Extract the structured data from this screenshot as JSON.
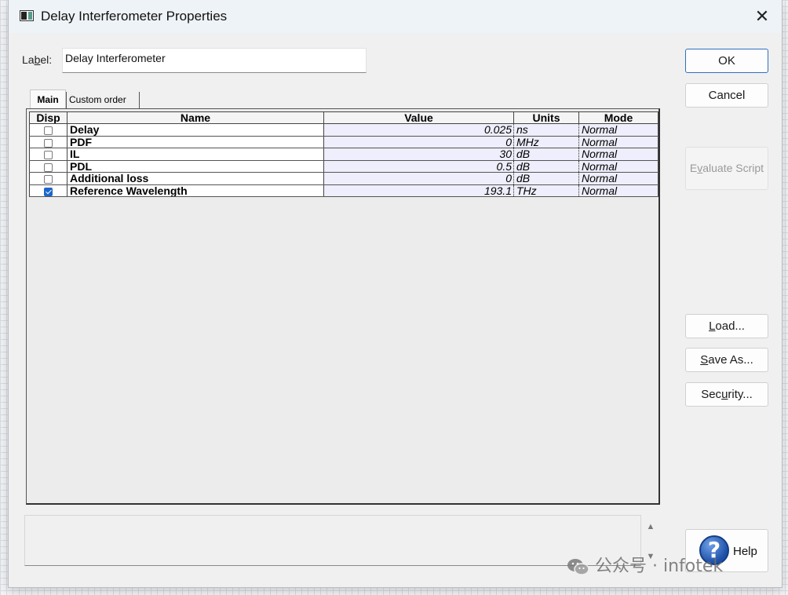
{
  "window": {
    "title": "Delay Interferometer Properties",
    "close_glyph": "✕"
  },
  "label_field": {
    "label_pre": "La",
    "label_key": "b",
    "label_post": "el:",
    "value": "Delay Interferometer"
  },
  "tabs": [
    {
      "label": "Main",
      "active": true
    },
    {
      "label": "Custom order",
      "active": false
    }
  ],
  "table": {
    "headers": [
      "Disp",
      "Name",
      "Value",
      "Units",
      "Mode"
    ],
    "rows": [
      {
        "disp": false,
        "name": "Delay",
        "value": "0.025",
        "units": "ns",
        "mode": "Normal"
      },
      {
        "disp": false,
        "name": "PDF",
        "value": "0",
        "units": "MHz",
        "mode": "Normal"
      },
      {
        "disp": false,
        "name": "IL",
        "value": "30",
        "units": "dB",
        "mode": "Normal"
      },
      {
        "disp": false,
        "name": "PDL",
        "value": "0.5",
        "units": "dB",
        "mode": "Normal"
      },
      {
        "disp": false,
        "name": "Additional loss",
        "value": "0",
        "units": "dB",
        "mode": "Normal"
      },
      {
        "disp": true,
        "name": "Reference Wavelength",
        "value": "193.1",
        "units": "THz",
        "mode": "Normal"
      }
    ]
  },
  "buttons": {
    "ok": "OK",
    "cancel": "Cancel",
    "evaluate_pre": "E",
    "evaluate_key": "v",
    "evaluate_post": "aluate Script",
    "load_pre": "",
    "load_key": "L",
    "load_post": "oad...",
    "save_pre": "",
    "save_key": "S",
    "save_post": "ave As...",
    "security_pre": "Sec",
    "security_key": "u",
    "security_post": "rity...",
    "help": "Help"
  },
  "help_icon_glyph": "?",
  "scroll": {
    "up": "▲",
    "down": "▼"
  },
  "watermark": "公众号 · infotek",
  "colors": {
    "accent": "#1d66c9",
    "value_cell_bg": "#eeeefc",
    "primary_border": "#2f6fc2"
  }
}
